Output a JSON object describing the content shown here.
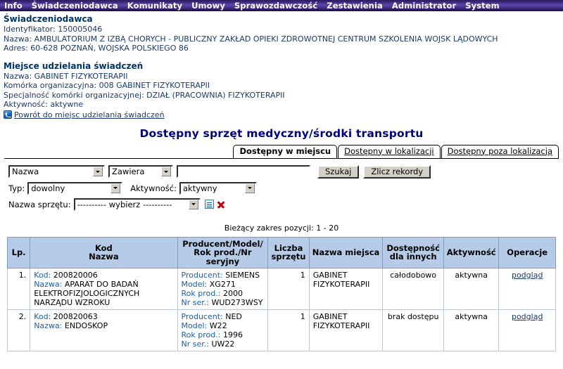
{
  "menubar": {
    "items": [
      {
        "label": "Info"
      },
      {
        "label": "Świadczeniodawca"
      },
      {
        "label": "Komunikaty"
      },
      {
        "label": "Umowy"
      },
      {
        "label": "Sprawozdawczość"
      },
      {
        "label": "Zestawienia"
      },
      {
        "label": "Administrator"
      },
      {
        "label": "System"
      }
    ]
  },
  "provider": {
    "title": "Świadczeniodawca",
    "identifier": "Identyfikator: 150005046",
    "name": "Nazwa: AMBULATORIUM Z IZBĄ CHORYCH - PUBLICZNY ZAKŁAD OPIEKI ZDROWOTNEJ CENTRUM SZKOLENIA WOJSK LĄDOWYCH",
    "address": "Adres: 60-628 POZNAŃ, WOJSKA POLSKIEGO 86"
  },
  "place": {
    "title": "Miejsce udzielania świadczeń",
    "name": "Nazwa: GABINET FIZYKOTERAPII",
    "unit": "Komórka organizacyjna: 008 GABINET FIZYKOTERAPII",
    "specialty": "Specjalność komórki organizacyjnej: DZIAŁ (PRACOWNIA) FIZYKOTERAPII",
    "activity": "Aktywność: aktywne",
    "back_link": "Powrót do miejsc udzielania świadczeń"
  },
  "page": {
    "title": "Dostępny sprzęt medyczny/środki transportu"
  },
  "tabs": [
    {
      "label": "Dostępny w miejscu",
      "active": true
    },
    {
      "label": "Dostępny w lokalizacji",
      "active": false
    },
    {
      "label": "Dostępny poza lokalizacją",
      "active": false
    }
  ],
  "filters": {
    "field_select": "Nazwa",
    "operator_select": "Zawiera",
    "query_value": "",
    "query_placeholder": "",
    "search_button": "Szukaj",
    "count_button": "Zlicz rekordy",
    "type_label": "Typ:",
    "type_select": "dowolny",
    "activity_label": "Aktywność:",
    "activity_select": "aktywny",
    "equipment_label": "Nazwa sprzętu:",
    "equipment_select": "---------- wybierz ----------"
  },
  "range_text": "Bieżący zakres pozycji: 1 - 20",
  "table": {
    "headers": {
      "lp": "Lp.",
      "kod_line1": "Kod",
      "kod_line2": "Nazwa",
      "prod_line1": "Producent/Model/",
      "prod_line2": "Rok prod./Nr seryjny",
      "ile_line1": "Liczba",
      "ile_line2": "sprzętu",
      "miejsce": "Nazwa miejsca",
      "dost_line1": "Dostępność",
      "dost_line2": "dla innych",
      "aktywnosc": "Aktywność",
      "operacje": "Operacje"
    },
    "labels": {
      "kod": "Kod:",
      "nazwa": "Nazwa:",
      "producent": "Producent:",
      "model": "Model:",
      "rok": "Rok prod.:",
      "nr": "Nr ser.:"
    },
    "rows": [
      {
        "lp": "1.",
        "kod": "200820006",
        "nazwa": "APARAT DO BADAŃ ELEKTROFIZJOLOGICZNYCH NARZĄDU WZROKU",
        "producent": "SIEMENS",
        "model": "XG271",
        "rok": "2000",
        "nr_ser": "WUD273WSY",
        "liczba": "1",
        "miejsce": "GABINET FIZYKOTERAPII",
        "dostepnosc": "całodobowo",
        "aktywnosc": "aktywna",
        "operacja": "podgląd"
      },
      {
        "lp": "2.",
        "kod": "200820063",
        "nazwa": "ENDOSKOP",
        "producent": "NED",
        "model": "W22",
        "rok": "1996",
        "nr_ser": "UW22",
        "liczba": "1",
        "miejsce": "GABINET FIZYKOTERAPII",
        "dostepnosc": "brak dostępu",
        "aktywnosc": "aktywna",
        "operacja": "podgląd"
      }
    ]
  },
  "colors": {
    "menu_purple": "#3b2a7a",
    "title_navy": "#000080",
    "header_blue": "#b5cbe7",
    "link_blue": "#1a3a6b",
    "field_label_blue": "#1d5fa8"
  }
}
